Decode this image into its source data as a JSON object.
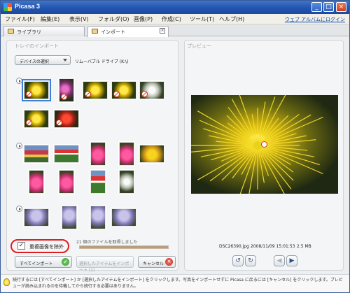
{
  "window": {
    "title": "Picasa 3",
    "min": "_",
    "max": "□",
    "close": "×"
  },
  "menu": {
    "items": [
      "ファイル(F)",
      "編集(E)",
      "表示(V)",
      "フォルダ(O)",
      "画像(P)",
      "作成(C)",
      "ツール(T)",
      "ヘルプ(H)"
    ],
    "web_album_link": "ウェブ アルバムにログイン"
  },
  "tabs": [
    {
      "label": "ライブラリ"
    },
    {
      "label": "インポート",
      "close": "×"
    }
  ],
  "import": {
    "tray_title": "トレイのインポート",
    "device_button": "デバイスの選択",
    "device_name": "リムーバブル ドライブ (K:\\)"
  },
  "preview": {
    "title": "プレビュー",
    "filename": "DSC26390.jpg",
    "datetime": "2008/11/09 15:01:53",
    "filesize": "2.5 MB"
  },
  "controls": {
    "exclude_duplicates_label": "重複画像を除外",
    "exclude_duplicates_checked": true,
    "status": "21 個のファイルを取得しました",
    "progress": 1.0,
    "import_all": "すべてインポート",
    "import_selected": "選択したアイテムをインポート (1)",
    "cancel": "キャンセル",
    "rotate_left": "↺",
    "rotate_right": "↻",
    "prev": "◀",
    "next": "▶"
  },
  "help_text": "続行するには [すべてインポート] か [選択したアイテムをインポート] をクリックします。写真をインポートせずに Picasa に戻るには [キャンセル] をクリックします。プレビューが読み込まれるのを待機してから続行する必要はありません。",
  "thumbnail_groups": [
    {
      "items": [
        "c-y",
        "c-p",
        "c-y",
        "c-y",
        "c-w",
        "c-y",
        "c-r"
      ],
      "excluded": [
        true,
        true,
        true,
        true,
        true,
        true,
        true
      ],
      "selected": [
        true,
        false,
        false,
        false,
        false,
        false,
        false
      ]
    },
    {
      "items": [
        "c-t",
        "c-tl",
        "c-tp",
        "c-tp",
        "c-ty",
        "c-tp",
        "c-tp",
        "c-tl",
        "c-w"
      ],
      "excluded": [
        false,
        false,
        false,
        false,
        false,
        false,
        false,
        false,
        false
      ],
      "selected": [
        false,
        false,
        false,
        false,
        false,
        false,
        false,
        false,
        false
      ]
    },
    {
      "items": [
        "c-wis",
        "c-wis",
        "c-wis",
        "c-wis"
      ],
      "excluded": [
        false,
        false,
        false,
        false
      ],
      "selected": [
        false,
        false,
        false,
        false
      ]
    }
  ]
}
